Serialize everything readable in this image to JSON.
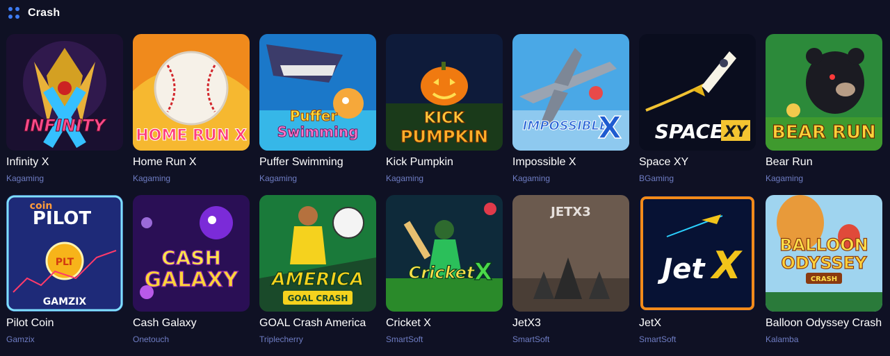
{
  "section": {
    "title": "Crash",
    "icon": "grid-dots-icon"
  },
  "colors": {
    "background": "#0f1124",
    "provider": "#6f7dc4",
    "accent": "#3d7bf2"
  },
  "games": [
    {
      "name": "Infinity X",
      "provider": "Kagaming",
      "art_text": "INFINITY"
    },
    {
      "name": "Home Run X",
      "provider": "Kagaming",
      "art_text": "HOME RUN X"
    },
    {
      "name": "Puffer Swimming",
      "provider": "Kagaming",
      "art_text": "Puffer Swimming"
    },
    {
      "name": "Kick Pumpkin",
      "provider": "Kagaming",
      "art_text": "KICK PUMPKIN"
    },
    {
      "name": "Impossible X",
      "provider": "Kagaming",
      "art_text": "IMPOSSIBLE X"
    },
    {
      "name": "Space XY",
      "provider": "BGaming",
      "art_text": "SPACE XY"
    },
    {
      "name": "Bear Run",
      "provider": "Kagaming",
      "art_text": "BEAR RUN"
    },
    {
      "name": "Pilot Coin",
      "provider": "Gamzix",
      "art_text": "coin PILOT"
    },
    {
      "name": "Cash Galaxy",
      "provider": "Onetouch",
      "art_text": "CASH GALAXY"
    },
    {
      "name": "GOAL Crash America",
      "provider": "Triplecherry",
      "art_text": "AMERICA"
    },
    {
      "name": "Cricket X",
      "provider": "SmartSoft",
      "art_text": "CricketX"
    },
    {
      "name": "JetX3",
      "provider": "SmartSoft",
      "art_text": "JETX3"
    },
    {
      "name": "JetX",
      "provider": "SmartSoft",
      "art_text": "JetX"
    },
    {
      "name": "Balloon Odyssey Crash",
      "provider": "Kalamba",
      "art_text": "BALLOON ODYSSEY"
    }
  ]
}
